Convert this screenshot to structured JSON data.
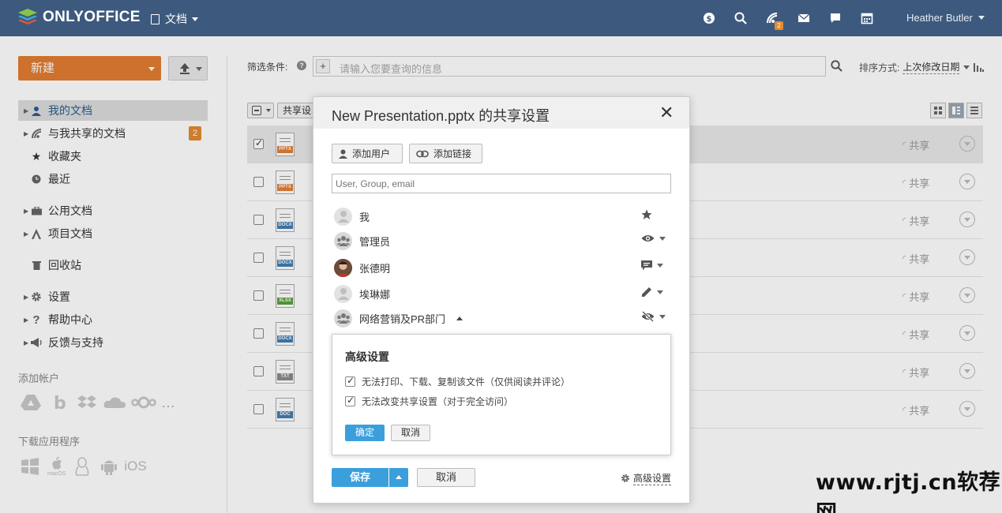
{
  "header": {
    "logo_text": "ONLYOFFICE",
    "module": "文档",
    "icons": [
      "coin-icon",
      "search-icon",
      "feed-icon",
      "mail-icon",
      "chat-icon",
      "calendar-icon"
    ],
    "feed_badge": "2",
    "user_name": "Heather Butler"
  },
  "sidebar": {
    "new_label": "新建",
    "items": [
      {
        "label": "我的文档"
      },
      {
        "label": "与我共享的文档",
        "badge": "2"
      },
      {
        "label": "收藏夹"
      },
      {
        "label": "最近"
      },
      {
        "label": "公用文档"
      },
      {
        "label": "项目文档"
      },
      {
        "label": "回收站"
      },
      {
        "label": "设置"
      },
      {
        "label": "帮助中心"
      },
      {
        "label": "反馈与支持"
      }
    ],
    "add_account": "添加帐户",
    "download_apps": "下载应用程序",
    "macos_label": "macOS",
    "ios_label": "iOS"
  },
  "filter": {
    "label": "筛选条件:",
    "placeholder": "请输入您要查询的信息",
    "sort_label": "排序方式:",
    "sort_value": "上次修改日期"
  },
  "toolbar": {
    "share_settings": "共享设"
  },
  "files": [
    {
      "type": "PPTX",
      "color": "#e0803a",
      "share": "共享",
      "checked": true
    },
    {
      "type": "PPTX",
      "color": "#e0803a",
      "share": "共享",
      "checked": false
    },
    {
      "type": "DOCX",
      "color": "#3f7fb4",
      "share": "共享",
      "checked": false
    },
    {
      "type": "DOCX",
      "color": "#3f7fb4",
      "share": "共享",
      "checked": false
    },
    {
      "type": "XLSX",
      "color": "#5aa03c",
      "share": "共享",
      "checked": false
    },
    {
      "type": "DOCX",
      "color": "#3f7fb4",
      "share": "共享",
      "checked": false
    },
    {
      "type": "TXT",
      "color": "#8a8a8a",
      "share": "共享",
      "checked": false
    },
    {
      "type": "DOC",
      "color": "#3f7fb4",
      "share": "共享",
      "checked": false
    }
  ],
  "dialog": {
    "title": "New Presentation.pptx 的共享设置",
    "add_user": "添加用户",
    "add_link": "添加链接",
    "input_placeholder": "User, Group, email",
    "shares": [
      {
        "name": "我",
        "right": "star-icon"
      },
      {
        "name": "管理员",
        "right": "eye-icon"
      },
      {
        "name": "张德明",
        "right": "comment-icon"
      },
      {
        "name": "埃琳娜",
        "right": "pencil-icon"
      },
      {
        "name": "网络营销及PR部门",
        "right": "eye-off-icon"
      }
    ],
    "advanced": {
      "title": "高级设置",
      "option1": "无法打印、下载、复制该文件（仅供阅读并评论）",
      "option2": "无法改变共享设置（对于完全访问）",
      "ok": "确定",
      "cancel": "取消"
    },
    "save": "保存",
    "cancel": "取消",
    "advanced_link": "高级设置"
  },
  "watermark": "www.rjtj.cn软荐网"
}
